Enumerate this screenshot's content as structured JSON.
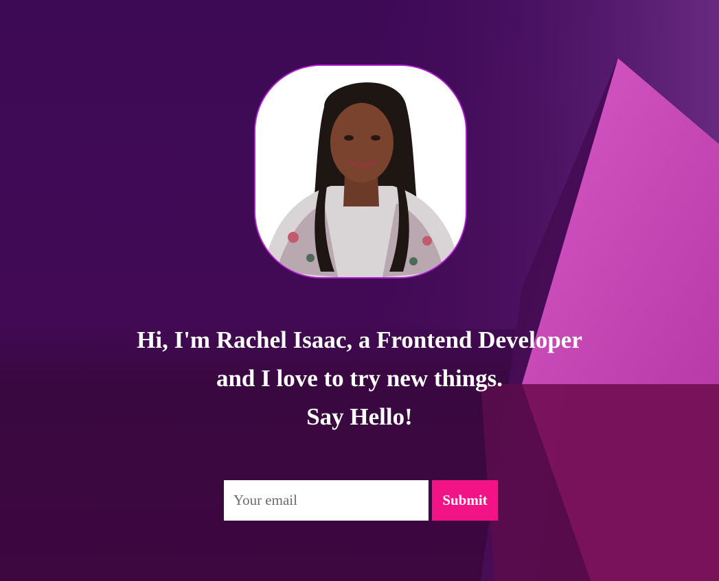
{
  "hero": {
    "avatar_icon": "profile-photo",
    "headline_line1": "Hi, I'm Rachel Isaac, a Frontend Developer",
    "headline_line2": "and I love to try new things.",
    "headline_line3": "Say Hello!"
  },
  "signup": {
    "email_placeholder": "Your email",
    "email_value": "",
    "submit_label": "Submit"
  },
  "colors": {
    "background": "#3d0a56",
    "accent": "#f21487",
    "avatar_border": "#b01fd0",
    "text": "#ffffff"
  }
}
